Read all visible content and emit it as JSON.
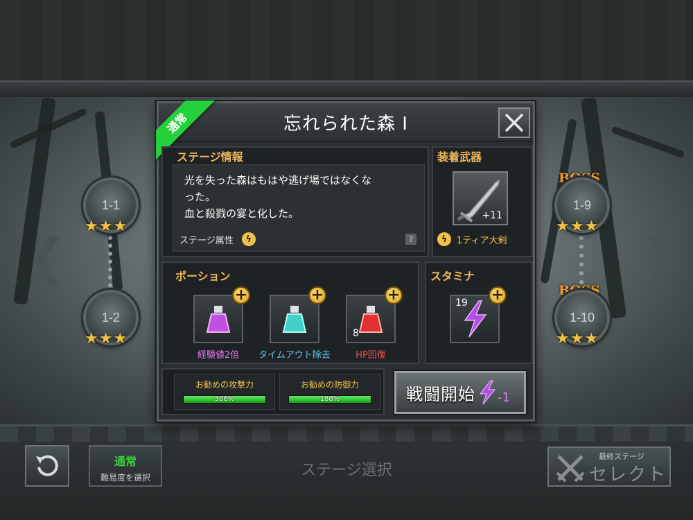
{
  "dialog": {
    "title": "忘れられた森 Ⅰ",
    "difficulty_ribbon": "通常",
    "close_icon": "close-icon"
  },
  "stage_info": {
    "label": "ステージ情報",
    "description_line1": "光を失った森はもはや逃げ場ではなくな",
    "description_line2": "った。",
    "description_line3": "血と殺戮の宴と化した。",
    "attribute_label": "ステージ属性",
    "help": "?"
  },
  "weapon": {
    "label": "装着武器",
    "level": "+11",
    "name": "1ティア大剣",
    "icon": "greatsword-icon"
  },
  "potions": {
    "label": "ポーション",
    "items": [
      {
        "name": "経験値2倍",
        "color": "#e07af0",
        "liquid": "#c050e0",
        "count": ""
      },
      {
        "name": "タイムアウト除去",
        "color": "#5ec8f0",
        "liquid": "#40d0c8",
        "count": ""
      },
      {
        "name": "HP回復",
        "color": "#f05050",
        "liquid": "#e03030",
        "count": "8"
      }
    ]
  },
  "stamina": {
    "label": "スタミナ",
    "count": "19"
  },
  "recommend": {
    "attack_label": "お勧めの攻撃力",
    "attack_value": "306%",
    "attack_fill": 1.0,
    "defense_label": "お勧めの防御力",
    "defense_value": "188%",
    "defense_fill": 1.0
  },
  "battle": {
    "label": "戦闘開始",
    "cost": "-1"
  },
  "map": {
    "nodes": [
      {
        "label": "1-1",
        "boss": "",
        "stars": 3
      },
      {
        "label": "1-2",
        "boss": "",
        "stars": 3
      },
      {
        "label": "1-9",
        "boss": "BOSS",
        "stars": 3
      },
      {
        "label": "1-10",
        "boss": "BOSS",
        "stars": 3
      }
    ]
  },
  "bottom": {
    "difficulty_value": "通常",
    "difficulty_caption": "難易度を選択",
    "screen_title": "ステージ選択",
    "select_caption": "最終ステージ",
    "select_label": "セレクト"
  },
  "colors": {
    "accent_gold": "#f0b85a",
    "ribbon_green": "#26d03c",
    "bar_green": "#3ad03a",
    "stamina_purple": "#b050e0"
  }
}
